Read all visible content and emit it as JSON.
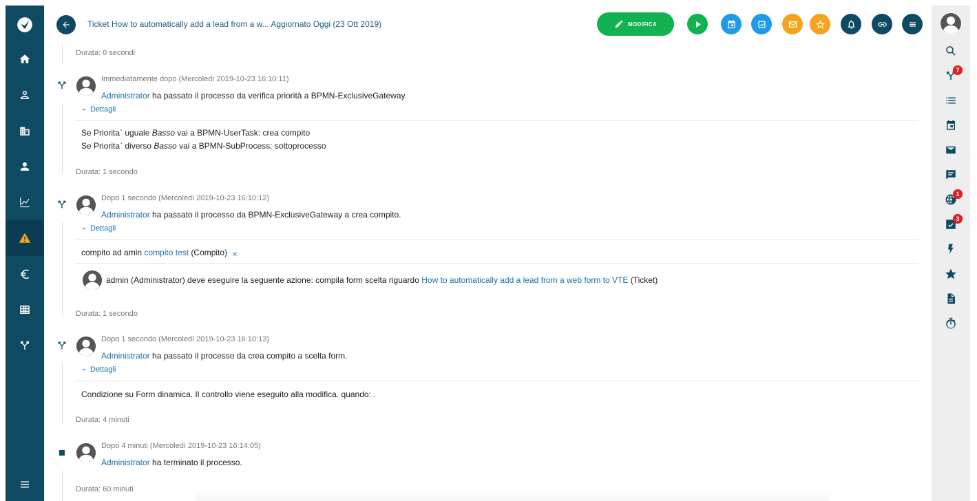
{
  "header": {
    "title": "Ticket How to automatically add a lead from a w... Aggiornato Oggi (23 Ott 2019)",
    "edit_label": "MODIFICA",
    "colors": {
      "sidebar": "#0f4a63",
      "green": "#12b250",
      "blue": "#1e9be8",
      "orange": "#f5a21d"
    }
  },
  "right_sidebar": {
    "badges": {
      "processes": "7",
      "globe": "1",
      "tasks": "3"
    }
  },
  "timeline": {
    "d0": "Durata: 0 secondi",
    "e1": {
      "time": "Immediatamente dopo (Mercoledì 2019-10-23 16:10:11)",
      "user": "Administrator",
      "action": " ha passato il processo da verifica priorità a BPMN-ExclusiveGateway.",
      "details": "Dettagli",
      "line1_pre": "Se Priorita` uguale ",
      "line1_em": "Basso",
      "line1_post": " vai a BPMN-UserTask: crea compito",
      "line2_pre": "Se Priorita` diverso ",
      "line2_em": "Basso",
      "line2_post": " vai a BPMN-SubProcess: sottoprocesso"
    },
    "d1": "Durata: 1 secondo",
    "e2": {
      "time": "Dopo 1 secondo (Mercoledì 2019-10-23 16:10:12)",
      "user": "Administrator",
      "action": " ha passato il processo da BPMN-ExclusiveGateway a crea compito.",
      "details": "Dettagli",
      "task_pre": "compito ad amin ",
      "task_link": "compito test",
      "task_post": " (Compito)",
      "action2_pre": "admin (Administrator) deve eseguire la seguente azione: compila form scelta riguardo ",
      "action2_link": "How to automatically add a lead from a web form to VTE",
      "action2_post": " (Ticket)"
    },
    "d2": "Durata: 1 secondo",
    "e3": {
      "time": "Dopo 1 secondo (Mercoledì 2019-10-23 16:10:13)",
      "user": "Administrator",
      "action": " ha passato il processo da crea compito a scelta form.",
      "details": "Dettagli",
      "detail": "Condizione su Form dinamica. Il controllo viene eseguito alla modifica. quando: ."
    },
    "d3": "Durata: 4 minuti",
    "e4": {
      "time": "Dopo 4 minuti (Mercoledì 2019-10-23 16:14:05)",
      "user": "Administrator",
      "action": " ha terminato il processo."
    },
    "d4": "Durata: 60 minuti"
  }
}
